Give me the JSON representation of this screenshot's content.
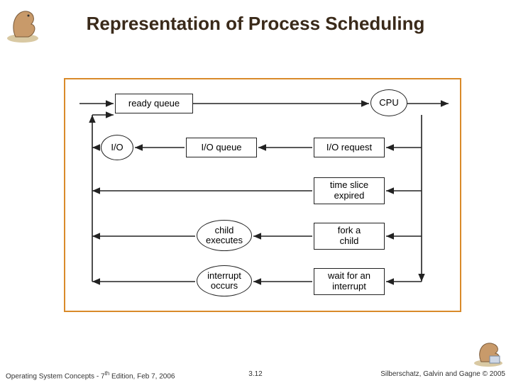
{
  "slide": {
    "title": "Representation of Process Scheduling",
    "page_number": "3.12"
  },
  "footer": {
    "left_a": "Operating System Concepts - 7",
    "left_sup": "th",
    "left_b": " Edition, Feb 7, 2006",
    "right": "Silberschatz, Galvin and Gagne © 2005"
  },
  "nodes": {
    "ready_queue": "ready queue",
    "cpu": "CPU",
    "io": "I/O",
    "io_queue": "I/O queue",
    "io_request": "I/O request",
    "time_slice": "time slice\nexpired",
    "child_executes": "child\nexecutes",
    "fork_child": "fork a\nchild",
    "interrupt_occurs": "interrupt\noccurs",
    "wait_interrupt": "wait for an\ninterrupt"
  },
  "diagram_meta": {
    "type": "queueing-diagram",
    "description": "Process scheduling: jobs cycle between ready queue and CPU; CPU dispatches to I/O request, time-slice expiry, fork-a-child, or wait-for-interrupt; each path returns to the ready queue.",
    "edges": [
      [
        "enter",
        "ready_queue"
      ],
      [
        "ready_queue",
        "cpu"
      ],
      [
        "cpu",
        "exit"
      ],
      [
        "cpu",
        "io_request"
      ],
      [
        "io_request",
        "io_queue"
      ],
      [
        "io_queue",
        "io"
      ],
      [
        "io",
        "ready_queue"
      ],
      [
        "cpu",
        "time_slice"
      ],
      [
        "time_slice",
        "ready_queue"
      ],
      [
        "cpu",
        "fork_child"
      ],
      [
        "fork_child",
        "child_executes"
      ],
      [
        "child_executes",
        "ready_queue"
      ],
      [
        "cpu",
        "wait_interrupt"
      ],
      [
        "wait_interrupt",
        "interrupt_occurs"
      ],
      [
        "interrupt_occurs",
        "ready_queue"
      ]
    ]
  }
}
